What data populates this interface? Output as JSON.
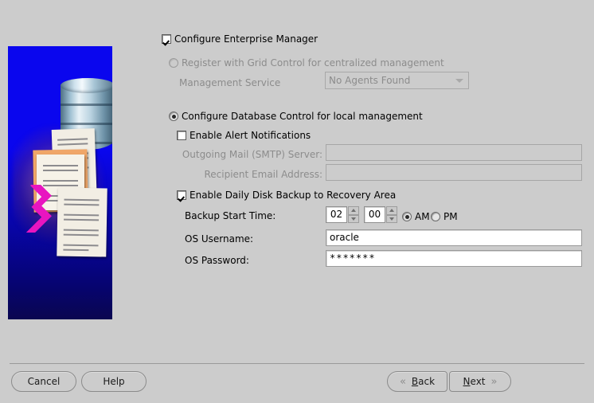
{
  "window": {
    "background_color": "#cccccc"
  },
  "artwork": {
    "name": "oracle-dbca-illustration",
    "background_top_color": "#0a06ee",
    "background_bottom_color": "#0a0650",
    "arrow_color": "#e815c0",
    "database_icon": "database-cylinder-icon",
    "documents_icon": "document-sheets-icon"
  },
  "form": {
    "configure_em": {
      "label": "Configure Enterprise Manager",
      "checked": true
    },
    "grid_control": {
      "label": "Register with Grid Control for centralized management",
      "selected": false,
      "enabled": false
    },
    "management_service": {
      "label": "Management Service",
      "value": "No Agents Found",
      "enabled": false
    },
    "db_control": {
      "label": "Configure Database Control for local management",
      "selected": true
    },
    "alert_notifications": {
      "label": "Enable Alert Notifications",
      "checked": false
    },
    "smtp_server": {
      "label": "Outgoing Mail (SMTP) Server:",
      "value": "",
      "enabled": false
    },
    "recipient_email": {
      "label": "Recipient Email Address:",
      "value": "",
      "enabled": false
    },
    "daily_backup": {
      "label": "Enable Daily Disk Backup to Recovery Area",
      "checked": true
    },
    "backup_start_time": {
      "label": "Backup Start Time:",
      "hours": "02",
      "minutes": "00",
      "am_label": "AM",
      "pm_label": "PM",
      "meridiem_selected": "AM"
    },
    "os_username": {
      "label": "OS Username:",
      "value": "oracle"
    },
    "os_password": {
      "label": "OS Password:",
      "value": "*******"
    }
  },
  "buttons": {
    "cancel": "Cancel",
    "help": "Help",
    "back": "Back",
    "back_mnemonic": "B",
    "back_rest": "ack",
    "next": "Next",
    "next_mnemonic": "N",
    "next_rest": "ext",
    "back_chevron": "«",
    "next_chevron": "»"
  }
}
